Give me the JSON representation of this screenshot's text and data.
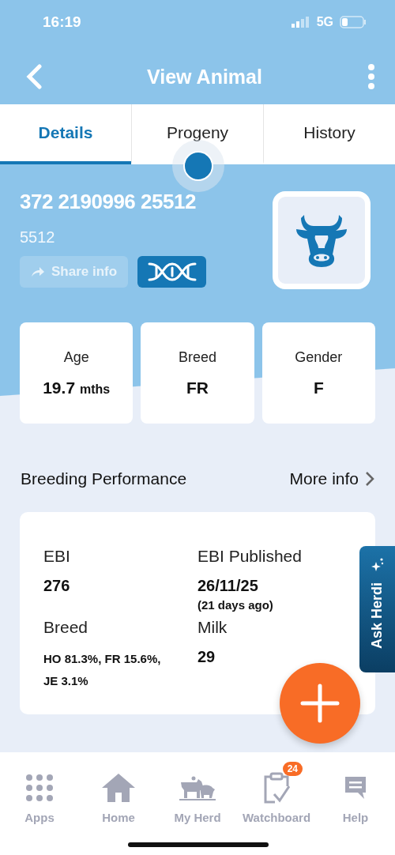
{
  "status_bar": {
    "time": "16:19",
    "network": "5G"
  },
  "header": {
    "title": "View Animal"
  },
  "tabs": [
    {
      "label": "Details",
      "selected": true
    },
    {
      "label": "Progeny",
      "selected": false
    },
    {
      "label": "History",
      "selected": false
    }
  ],
  "animal": {
    "tag": "372 2190996 25512",
    "short_id": "5512",
    "share_button": {
      "label": "Share info",
      "disabled": true
    }
  },
  "stats": [
    {
      "label": "Age",
      "value": "19.7",
      "unit": "mths"
    },
    {
      "label": "Breed",
      "value": "FR"
    },
    {
      "label": "Gender",
      "value": "F"
    }
  ],
  "breeding": {
    "title": "Breeding Performance",
    "link": "More info",
    "fields": [
      {
        "label": "EBI",
        "value": "276"
      },
      {
        "label": "EBI Published",
        "value": "26/11/25",
        "note": "(21 days ago)"
      },
      {
        "label": "Breed",
        "value": "HO 81.3%, FR 15.6%, JE 3.1%",
        "small": true
      },
      {
        "label": "Milk",
        "value": "29"
      }
    ]
  },
  "ask_button": {
    "label": "Ask Herdi"
  },
  "nav": [
    {
      "kind": "apps",
      "label": "Apps"
    },
    {
      "kind": "home",
      "label": "Home"
    },
    {
      "kind": "herd",
      "label": "My Herd"
    },
    {
      "kind": "watchboard",
      "label": "Watchboard",
      "badge": "24"
    },
    {
      "kind": "help",
      "label": "Help"
    }
  ]
}
